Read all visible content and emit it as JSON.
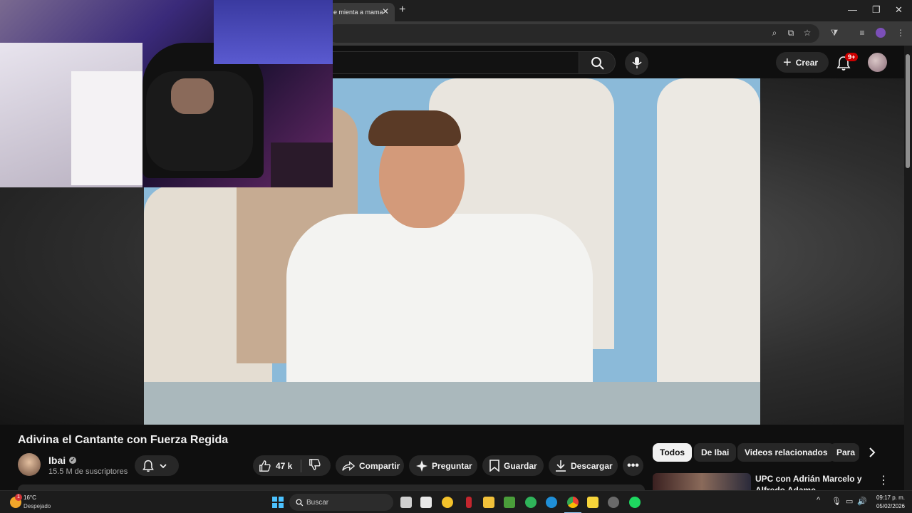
{
  "browser": {
    "tab_title": "e mienta a mama",
    "tab_close": "✕",
    "new_tab": "+"
  },
  "youtube": {
    "create_label": "Crear",
    "notif_badge": "9+"
  },
  "video": {
    "title": "Adivina el Cantante con Fuerza Regida",
    "channel_name": "Ibai",
    "subscribers": "15.5 M de suscriptores",
    "likes": "47 k",
    "share_label": "Compartir",
    "ask_label": "Preguntar",
    "save_label": "Guardar",
    "download_label": "Descargar"
  },
  "sidebar": {
    "chips": [
      "Todos",
      "De Ibai",
      "Videos relacionados",
      "Para"
    ],
    "related_title": "UPC con Adrián Marcelo y Alfredo Adame"
  },
  "taskbar": {
    "temperature": "16°C",
    "weather": "Despejado",
    "weather_badge": "1",
    "search_placeholder": "Buscar",
    "time": "09:17 p. m.",
    "date": "05/02/2026"
  },
  "colors": {
    "accent_red": "#cc0000",
    "bg": "#0f0f0f",
    "chip_active": "#f1f1f1"
  }
}
